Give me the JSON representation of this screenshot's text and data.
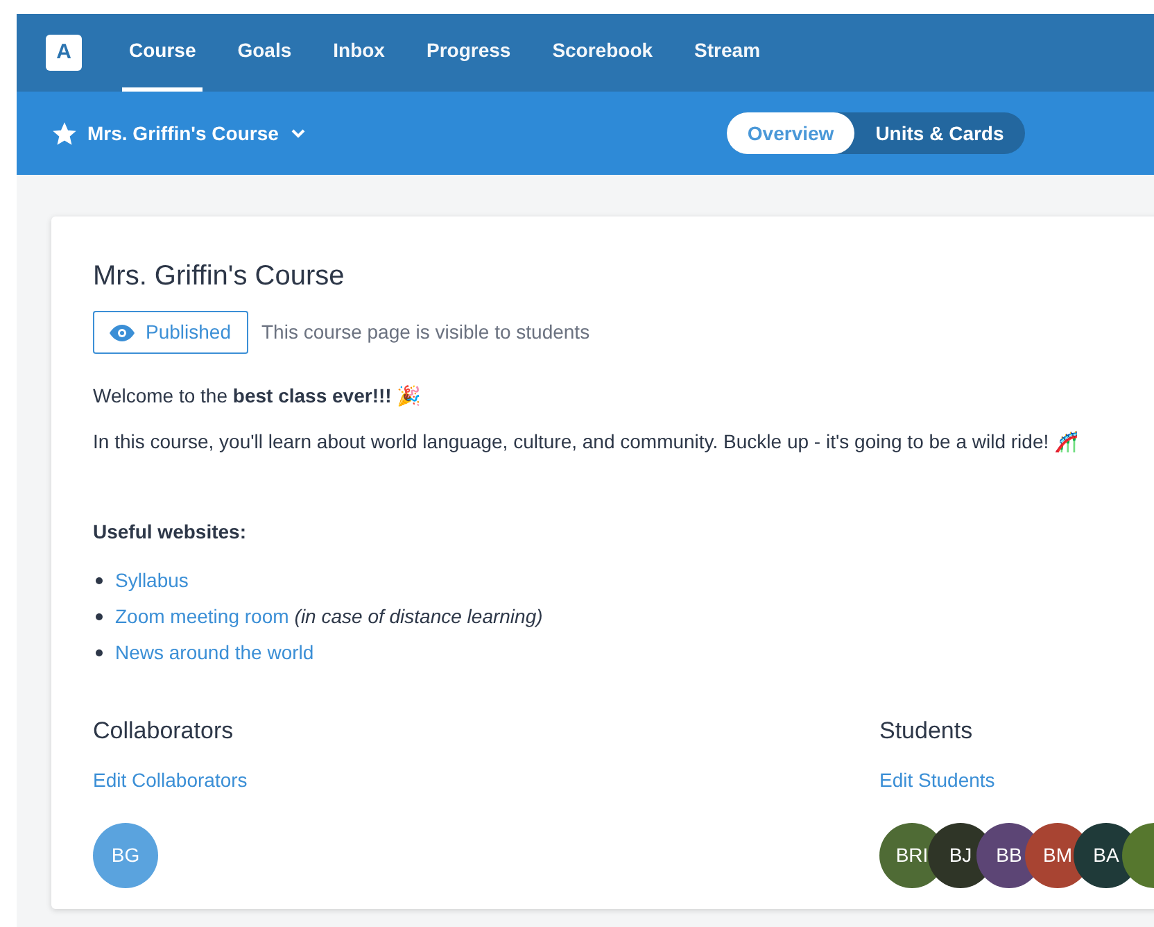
{
  "logo": "A",
  "nav": [
    {
      "label": "Course",
      "selected": true
    },
    {
      "label": "Goals",
      "selected": false
    },
    {
      "label": "Inbox",
      "selected": false
    },
    {
      "label": "Progress",
      "selected": false
    },
    {
      "label": "Scorebook",
      "selected": false
    },
    {
      "label": "Stream",
      "selected": false
    }
  ],
  "course_menu": {
    "title": "Mrs. Griffin's Course",
    "starred": true
  },
  "view_tabs": [
    {
      "label": "Overview",
      "selected": true
    },
    {
      "label": "Units & Cards",
      "selected": false
    }
  ],
  "card": {
    "title": "Mrs. Griffin's Course",
    "status": {
      "label": "Published",
      "note": "This course page is visible to students"
    },
    "paragraphs": [
      "Welcome to the **best class ever!!!** 🎉",
      "In this course, you'll learn about world language, culture, and community. Buckle up - it's going to be a wild ride! 🎢"
    ],
    "links_heading": "Useful websites:",
    "links": [
      {
        "label": "Syllabus"
      },
      {
        "label": "Zoom meeting room",
        "note": "(in case of distance learning)"
      },
      {
        "label": "News around the world"
      }
    ],
    "collaborators": {
      "heading": "Collaborators",
      "action": "Edit Collaborators",
      "people": [
        {
          "initials": "BG",
          "color": "#5aa3de"
        }
      ]
    },
    "students": {
      "heading": "Students",
      "action": "Edit Students",
      "people": [
        {
          "initials": "BRI",
          "color": "#4f6b35"
        },
        {
          "initials": "BJ",
          "color": "#2f3527"
        },
        {
          "initials": "BB",
          "color": "#5c4575"
        },
        {
          "initials": "BM",
          "color": "#a84432"
        },
        {
          "initials": "BA",
          "color": "#1f3a39"
        },
        {
          "color": "#56772e"
        }
      ]
    }
  }
}
